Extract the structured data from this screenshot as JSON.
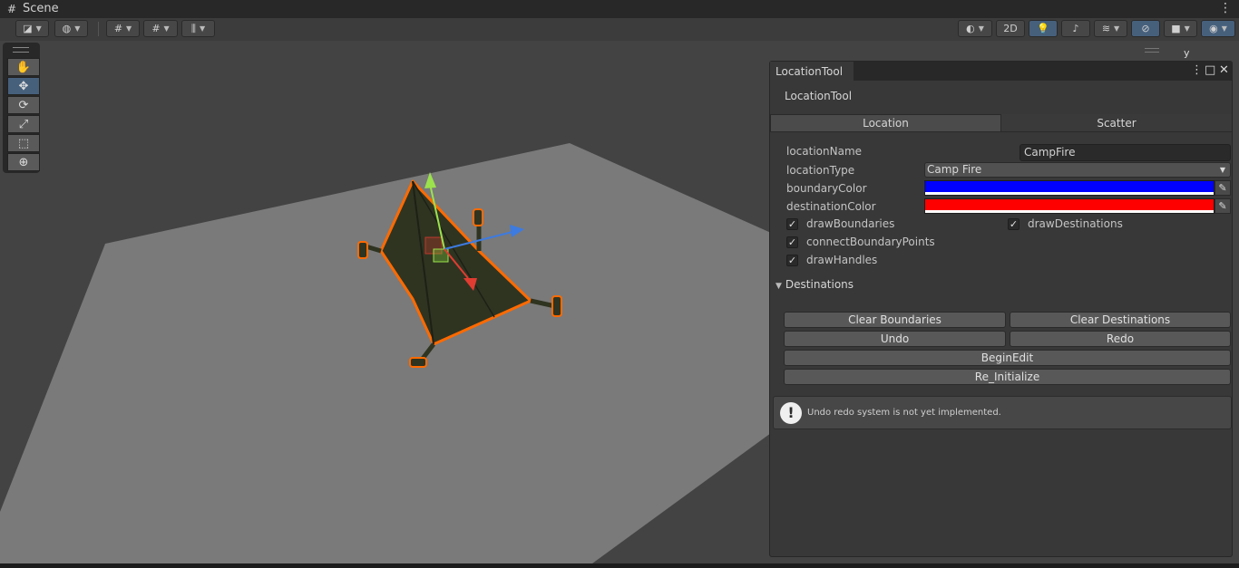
{
  "window": {
    "title": "Scene",
    "menu_icon": "kebab-icon"
  },
  "toolbar": {
    "view_mode_label": "2D",
    "left_icons": [
      "draw-mode-icon",
      "global-icon",
      "grid-snap-icon",
      "increment-snap-icon",
      "align-icon"
    ],
    "right_icons": [
      "shading-icon",
      "lighting-icon",
      "audio-icon",
      "effects-icon",
      "visibility-icon",
      "camera-icon",
      "gizmos-icon"
    ]
  },
  "tools": [
    "hand-tool",
    "move-tool",
    "rotate-tool",
    "scale-tool",
    "rect-tool",
    "transform-tool"
  ],
  "scene": {
    "axis_label": "y"
  },
  "panel": {
    "tab_title": "LocationTool",
    "header": "LocationTool",
    "tabs": [
      {
        "label": "Location",
        "selected": true
      },
      {
        "label": "Scatter",
        "selected": false
      }
    ],
    "fields": {
      "locationName": {
        "label": "locationName",
        "value": "CampFire"
      },
      "locationType": {
        "label": "locationType",
        "value": "Camp Fire"
      },
      "boundaryColor": {
        "label": "boundaryColor",
        "color": "#0000ff"
      },
      "destinationColor": {
        "label": "destinationColor",
        "color": "#ff0000"
      }
    },
    "toggles": {
      "drawBoundaries": {
        "label": "drawBoundaries",
        "checked": true
      },
      "drawDestinations": {
        "label": "drawDestinations",
        "checked": true
      },
      "connectBoundaryPoints": {
        "label": "connectBoundaryPoints",
        "checked": true
      },
      "drawHandles": {
        "label": "drawHandles",
        "checked": true
      }
    },
    "foldout": {
      "label": "Destinations",
      "expanded": true
    },
    "buttons": {
      "clear_boundaries": "Clear Boundaries",
      "clear_destinations": "Clear Destinations",
      "undo": "Undo",
      "redo": "Redo",
      "begin_edit": "BeginEdit",
      "re_initialize": "Re_Initialize"
    },
    "help": {
      "icon": "warning-icon",
      "text": "Undo redo system is not yet implemented."
    }
  },
  "colors": {
    "accent": "#46607c",
    "selection_outline": "#ff6a00",
    "tent": "#2e3320"
  }
}
